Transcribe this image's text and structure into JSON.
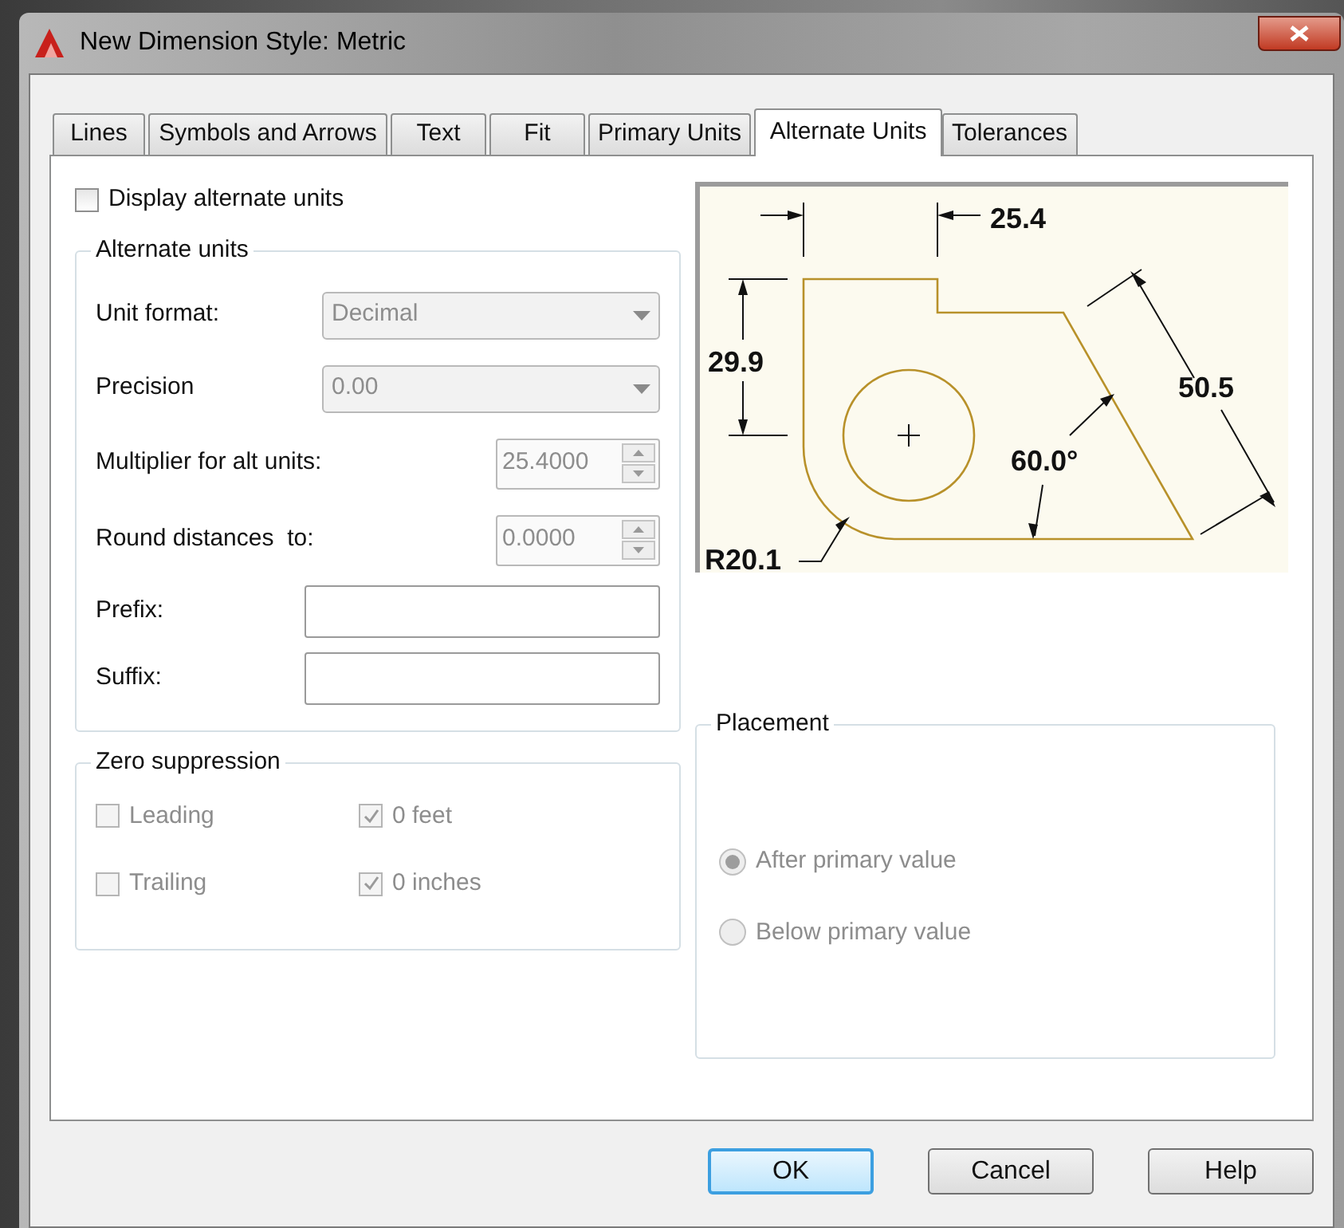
{
  "window": {
    "title": "New Dimension Style: Metric"
  },
  "tabs": [
    {
      "label": "Lines",
      "selected": false
    },
    {
      "label": "Symbols and Arrows",
      "selected": false
    },
    {
      "label": "Text",
      "selected": false
    },
    {
      "label": "Fit",
      "selected": false
    },
    {
      "label": "Primary Units",
      "selected": false
    },
    {
      "label": "Alternate Units",
      "selected": true
    },
    {
      "label": "Tolerances",
      "selected": false
    }
  ],
  "display_alternate_units": {
    "label": "Display alternate units",
    "checked": false
  },
  "alternate_units": {
    "title": "Alternate units",
    "fields": [
      {
        "kind": "dropdown",
        "label": "Unit format:",
        "value": "Decimal",
        "disabled": true
      },
      {
        "kind": "dropdown",
        "label": "Precision",
        "value": "0.00",
        "disabled": true
      },
      {
        "kind": "spinner",
        "label": "Multiplier for alt units:",
        "value": "25.4000",
        "disabled": true
      },
      {
        "kind": "spinner",
        "label": "Round distances  to:",
        "value": "0.0000",
        "disabled": true
      },
      {
        "kind": "text",
        "label": "Prefix:",
        "disabled": false
      },
      {
        "kind": "text",
        "label": "Suffix:",
        "disabled": false
      }
    ]
  },
  "zero_suppression": {
    "title": "Zero suppression",
    "options": [
      {
        "label": "Leading",
        "checked": false,
        "disabled": true
      },
      {
        "label": "0 feet",
        "checked": true,
        "disabled": true
      },
      {
        "label": "Trailing",
        "checked": false,
        "disabled": true
      },
      {
        "label": "0 inches",
        "checked": true,
        "disabled": true
      }
    ]
  },
  "preview": {
    "labels": [
      "25.4",
      "29.9",
      "50.5",
      "60.0°",
      "R20.1"
    ]
  },
  "placement": {
    "title": "Placement",
    "options": [
      {
        "label": "After primary value",
        "selected": true,
        "disabled": true
      },
      {
        "label": "Below primary value",
        "selected": false,
        "disabled": true
      }
    ]
  },
  "buttons": [
    {
      "label": "OK",
      "default": true
    },
    {
      "label": "Cancel",
      "default": false
    },
    {
      "label": "Help",
      "default": false
    }
  ]
}
